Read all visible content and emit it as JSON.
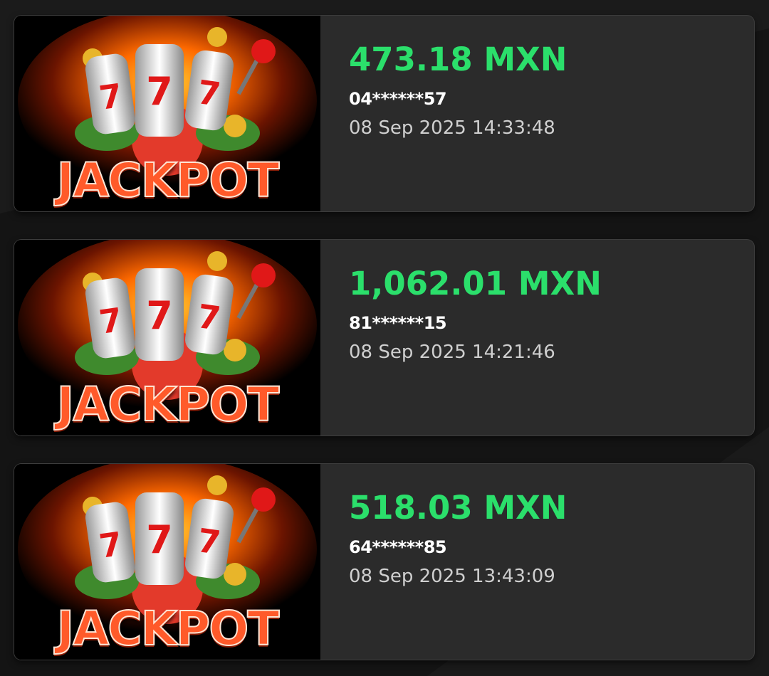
{
  "wins": [
    {
      "game_title": "JACKPOT",
      "amount": "473.18 MXN",
      "user": "04******57",
      "time": "08 Sep 2025 14:33:48"
    },
    {
      "game_title": "JACKPOT",
      "amount": "1,062.01 MXN",
      "user": "81******15",
      "time": "08 Sep 2025 14:21:46"
    },
    {
      "game_title": "JACKPOT",
      "amount": "518.03 MXN",
      "user": "64******85",
      "time": "08 Sep 2025 13:43:09"
    }
  ],
  "colors": {
    "amount": "#2bdf6b",
    "card_bg": "#2b2b2b",
    "page_bg": "#141414",
    "jackpot_text": "#ff5a2a"
  },
  "icons": {
    "thumbnail": "slot-machine-jackpot-icon"
  }
}
